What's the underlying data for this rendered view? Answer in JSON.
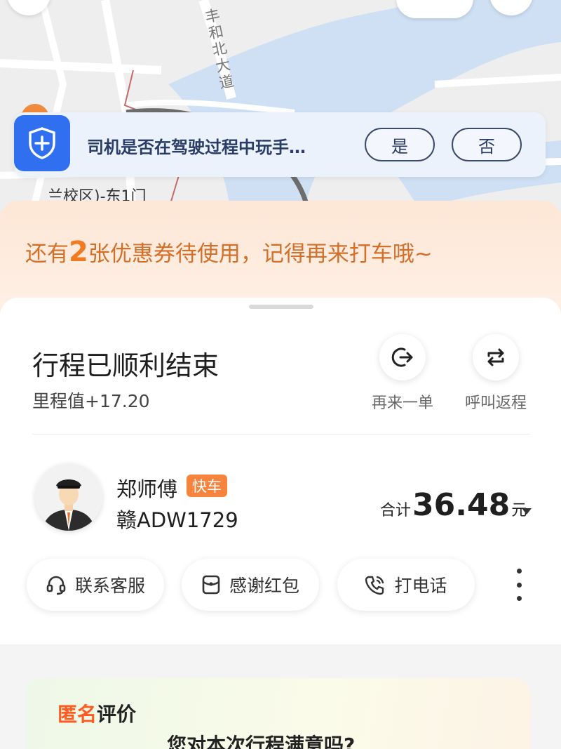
{
  "map": {
    "road_name": "丰和北大道",
    "poi_label": "兰校区)-东1门"
  },
  "safety_banner": {
    "question": "司机是否在驾驶过程中玩手…",
    "yes_label": "是",
    "no_label": "否"
  },
  "coupon": {
    "prefix": "还有",
    "count": "2",
    "suffix": "张优惠券待使用，记得再来打车哦~"
  },
  "trip": {
    "title": "行程已顺利结束",
    "mileage": "里程值+17.20",
    "actions": [
      {
        "label": "再来一单",
        "icon": "reorder-icon"
      },
      {
        "label": "呼叫返程",
        "icon": "return-trip-icon"
      }
    ]
  },
  "driver": {
    "name": "郑师傅",
    "car_type": "快车",
    "plate": "赣ADW1729"
  },
  "fare": {
    "prefix": "合计",
    "amount": "36.48",
    "unit": "元"
  },
  "bottom_actions": [
    {
      "label": "联系客服",
      "icon": "headset-icon"
    },
    {
      "label": "感谢红包",
      "icon": "red-envelope-icon"
    },
    {
      "label": "打电话",
      "icon": "phone-icon"
    }
  ],
  "rating": {
    "brand_a": "匿名",
    "brand_b": "评价",
    "question": "您对本次行程满意吗?"
  },
  "colors": {
    "accent_orange": "#f7843d",
    "safety_blue": "#2f6ff0",
    "coupon_text": "#d2702a"
  }
}
